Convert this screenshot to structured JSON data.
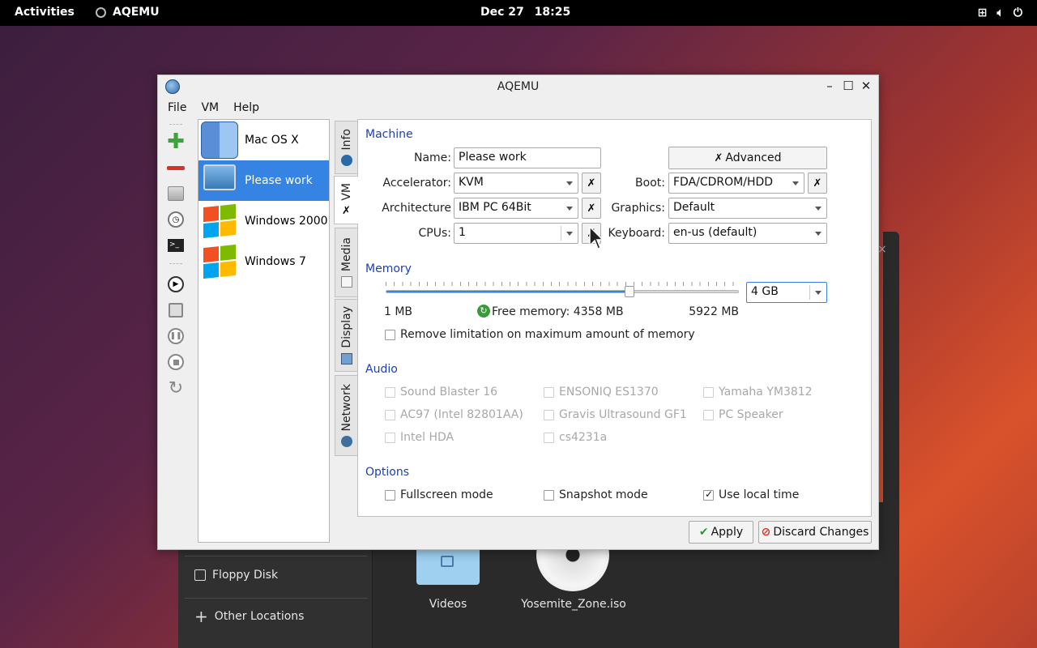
{
  "topbar": {
    "activities": "Activities",
    "app_name": "AQEMU",
    "date": "Dec 27",
    "time": "18:25"
  },
  "filemanager": {
    "sidebar": [
      {
        "label": "Floppy Disk",
        "icon": "floppy-icon"
      },
      {
        "label": "Other Locations",
        "icon": "plus-icon"
      }
    ],
    "files": [
      {
        "label": "Videos",
        "icon": "videos-folder-icon"
      },
      {
        "label": "Yosemite_Zone.iso",
        "icon": "disc-icon"
      }
    ]
  },
  "window": {
    "title": "AQEMU",
    "menu": [
      "File",
      "VM",
      "Help"
    ]
  },
  "vm_list": [
    {
      "name": "Mac OS X",
      "icon": "macos-icon",
      "selected": false
    },
    {
      "name": "Please work",
      "icon": "pc-icon",
      "selected": true
    },
    {
      "name": "Windows 2000",
      "icon": "windows-icon",
      "selected": false
    },
    {
      "name": "Windows 7",
      "icon": "windows-icon",
      "selected": false
    }
  ],
  "tabs": [
    {
      "label": "Info",
      "icon": "info-icon",
      "active": false
    },
    {
      "label": "VM",
      "icon": "tools-icon",
      "active": true
    },
    {
      "label": "Media",
      "icon": "media-icon",
      "active": false
    },
    {
      "label": "Display",
      "icon": "display-icon",
      "active": false
    },
    {
      "label": "Network",
      "icon": "network-icon",
      "active": false
    }
  ],
  "machine": {
    "section": "Machine",
    "name_label": "Name:",
    "name_value": "Please work",
    "advanced_label": "Advanced",
    "accelerator_label": "Accelerator:",
    "accelerator_value": "KVM",
    "boot_label": "Boot:",
    "boot_value": "FDA/CDROM/HDD",
    "architecture_label": "Architecture",
    "architecture_value": "IBM PC 64Bit",
    "graphics_label": "Graphics:",
    "graphics_value": "Default",
    "cpus_label": "CPUs:",
    "cpus_value": "1",
    "keyboard_label": "Keyboard:",
    "keyboard_value": "en-us (default)"
  },
  "memory": {
    "section": "Memory",
    "value": "4 GB",
    "min_label": "1 MB",
    "free_label": "Free memory: 4358 MB",
    "max_label": "5922 MB",
    "slider_fraction": 0.69,
    "remove_limit_label": "Remove limitation on maximum amount of memory",
    "remove_limit_checked": false
  },
  "audio": {
    "section": "Audio",
    "cards": [
      "Sound Blaster 16",
      "ENSONIQ ES1370",
      "Yamaha YM3812",
      "AC97 (Intel 82801AA)",
      "Gravis Ultrasound GF1",
      "PC Speaker",
      "Intel HDA",
      "cs4231a"
    ]
  },
  "options": {
    "section": "Options",
    "fullscreen_label": "Fullscreen mode",
    "fullscreen_checked": false,
    "snapshot_label": "Snapshot mode",
    "snapshot_checked": false,
    "localtime_label": "Use local time",
    "localtime_checked": true
  },
  "footer": {
    "apply_label": "Apply",
    "discard_label": "Discard Changes"
  },
  "colors": {
    "section_title": "#1c3fb0",
    "selection": "#3584e4"
  }
}
